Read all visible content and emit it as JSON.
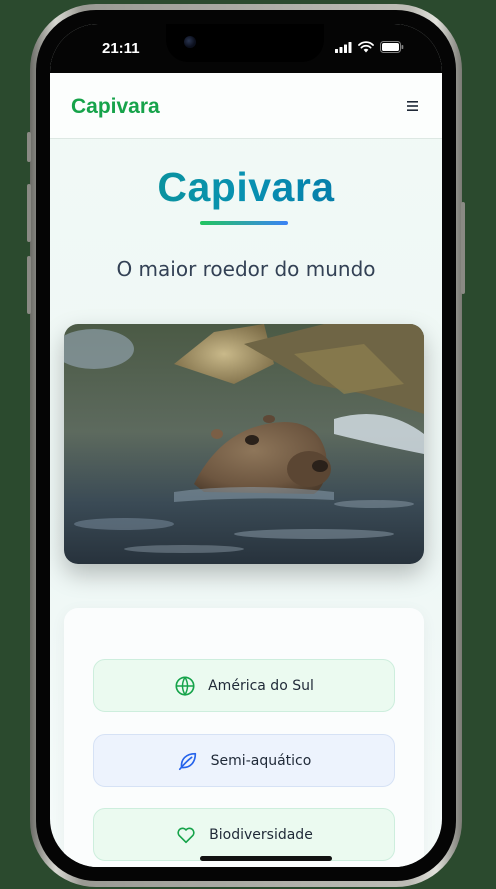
{
  "status": {
    "time": "21:11"
  },
  "nav": {
    "brand": "Capivara"
  },
  "hero": {
    "title": "Capivara",
    "subtitle": "O maior roedor do mundo"
  },
  "features": [
    {
      "label": "América do Sul",
      "icon": "globe-icon"
    },
    {
      "label": "Semi-aquático",
      "icon": "leaf-icon"
    },
    {
      "label": "Biodiversidade",
      "icon": "heart-icon"
    }
  ],
  "colors": {
    "background": "#2b4a2e",
    "brand_green": "#16a34a",
    "title_gradient_start": "#0d9488",
    "title_gradient_end": "#0369a1",
    "accent_blue": "#2563eb"
  }
}
